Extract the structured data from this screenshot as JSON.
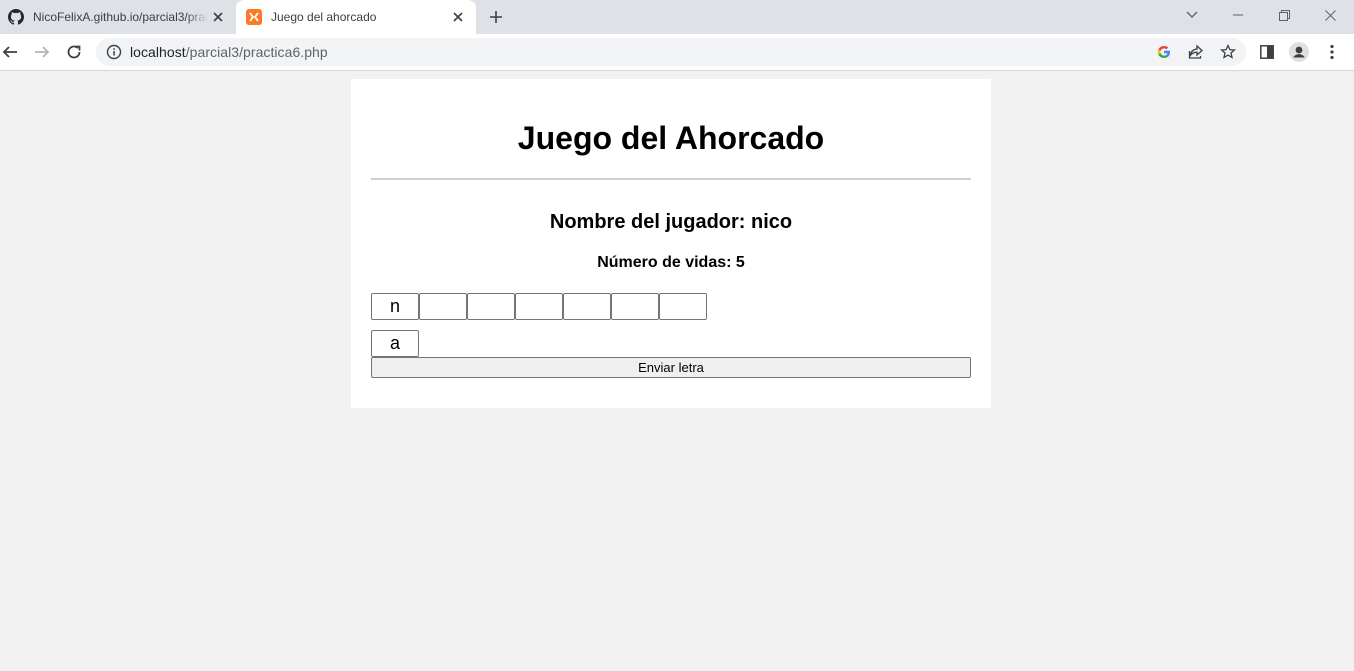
{
  "browser": {
    "tabs": [
      {
        "title": "NicoFelixA.github.io/parcial3/practica6",
        "favicon": "github-icon",
        "active": false
      },
      {
        "title": "Juego del ahorcado",
        "favicon": "xampp-icon",
        "active": true
      }
    ],
    "address": {
      "host": "localhost",
      "path": "/parcial3/practica6.php"
    },
    "icons": {
      "back": "arrow-left-icon",
      "forward": "arrow-right-icon",
      "reload": "reload-icon",
      "info": "info-icon",
      "google": "google-icon",
      "share": "share-icon",
      "bookmark": "star-icon",
      "side_panel": "side-panel-icon",
      "profile": "avatar-icon",
      "menu": "kebab-menu-icon"
    }
  },
  "game": {
    "title": "Juego del Ahorcado",
    "player_line": "Nombre del jugador: nico",
    "lives_line": "Número de vidas: 5",
    "word_letters": [
      "n",
      "",
      "",
      "",
      "",
      "",
      ""
    ],
    "guess_value": "a",
    "submit_label": "Enviar letra"
  },
  "colors": {
    "page_background": "#f1f1f1",
    "card_background": "#ffffff",
    "tabstrip": "#dee1e6"
  }
}
